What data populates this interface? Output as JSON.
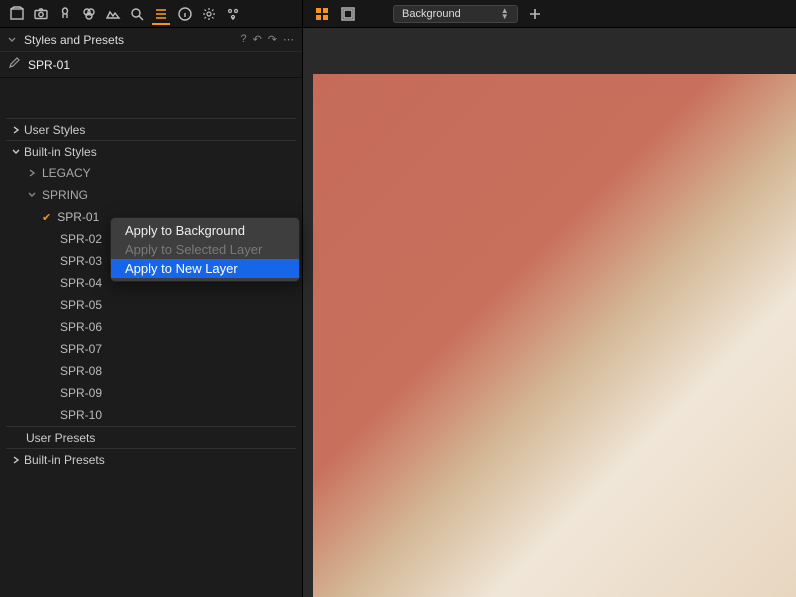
{
  "sidebar": {
    "panel_title": "Styles and Presets",
    "selected_style": "SPR-01",
    "sections": {
      "user_styles": {
        "label": "User Styles",
        "expanded": false
      },
      "builtin_styles": {
        "label": "Built-in Styles",
        "expanded": true,
        "children": [
          {
            "label": "LEGACY",
            "expanded": false
          },
          {
            "label": "SPRING",
            "expanded": true,
            "items": [
              {
                "label": "SPR-01",
                "checked": true
              },
              {
                "label": "SPR-02"
              },
              {
                "label": "SPR-03"
              },
              {
                "label": "SPR-04"
              },
              {
                "label": "SPR-05"
              },
              {
                "label": "SPR-06"
              },
              {
                "label": "SPR-07"
              },
              {
                "label": "SPR-08"
              },
              {
                "label": "SPR-09"
              },
              {
                "label": "SPR-10"
              }
            ]
          }
        ]
      },
      "user_presets": {
        "label": "User Presets",
        "expanded": false
      },
      "builtin_presets": {
        "label": "Built-in Presets",
        "expanded": false
      }
    },
    "actions": {
      "help": "?",
      "undo": "↶",
      "redo": "↷",
      "more": "⋯"
    }
  },
  "main": {
    "layer_select": "Background"
  },
  "context_menu": {
    "items": [
      {
        "label": "Apply to Background",
        "enabled": true
      },
      {
        "label": "Apply to Selected Layer",
        "enabled": false
      },
      {
        "label": "Apply to New Layer",
        "enabled": true,
        "highlighted": true
      }
    ]
  }
}
